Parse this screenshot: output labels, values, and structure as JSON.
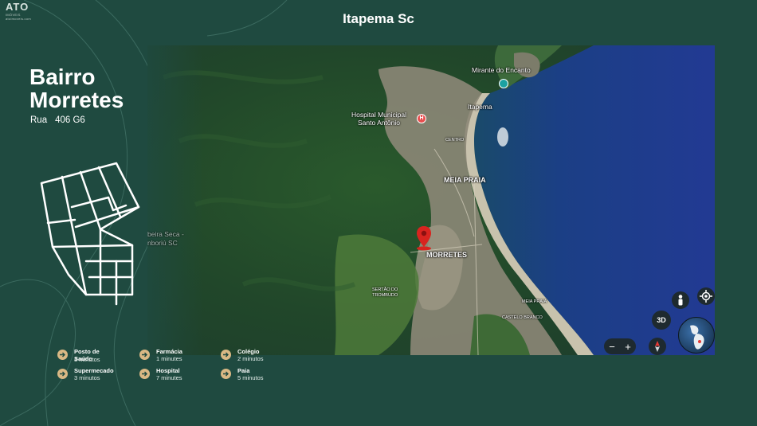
{
  "logo": {
    "main": "ATO",
    "sub": "IMÓVEIS",
    "sub2": "atoimoveis.com"
  },
  "title": "Itapema Sc",
  "neighborhood": {
    "line1": "Bairro",
    "line2": "Morretes",
    "street_label": "Rua",
    "street_value": "406 G6"
  },
  "map": {
    "labels": {
      "mirante": "Mirante do Encanto",
      "hospital": "Hospital Municipal\nSanto Antônio",
      "itapema": "Itapema",
      "centro": "CENTRO",
      "meia_praia": "MEIA PRAIA",
      "morretes": "MORRETES",
      "sertao": "SERTÃO DO\nTROMBUDO",
      "meia_praia_small": "MEIA PRAIA",
      "castelo": "CASTELO BRANCO",
      "ribeira": "beira Seca -\nnboriú SC"
    },
    "controls": {
      "threeD": "3D",
      "zoom_out": "−",
      "zoom_in": "+"
    },
    "colors": {
      "ocean": "#1d3e88",
      "forest": "#214a2a",
      "urban": "#8f8a7a",
      "pin": "#d8241f"
    }
  },
  "legend": [
    {
      "name": "Posto de Saúde",
      "time": "3 minutos"
    },
    {
      "name": "Farmácia",
      "time": "1 minutes"
    },
    {
      "name": "Colégio",
      "time": "2 minutos"
    },
    {
      "name": "Supermecado",
      "time": "3 minutos"
    },
    {
      "name": "Hospital",
      "time": "7 minutes"
    },
    {
      "name": "Paia",
      "time": "5 minutos"
    }
  ]
}
